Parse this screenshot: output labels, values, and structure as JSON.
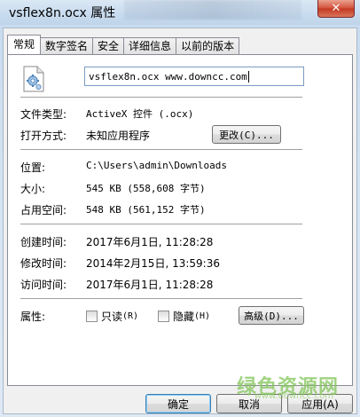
{
  "window": {
    "title": "vsflex8n.ocx 属性",
    "close_glyph": "✕"
  },
  "tabs": [
    {
      "label": "常规",
      "active": true
    },
    {
      "label": "数字签名",
      "active": false
    },
    {
      "label": "安全",
      "active": false
    },
    {
      "label": "详细信息",
      "active": false
    },
    {
      "label": "以前的版本",
      "active": false
    }
  ],
  "general": {
    "file_name": "vsflex8n.ocx  www.downcc.com",
    "file_icon": "activex-file-icon",
    "type_label": "文件类型:",
    "type_value": "ActiveX 控件 (.ocx)",
    "opens_with_label": "打开方式:",
    "opens_with_value": "未知应用程序",
    "change_button": "更改(C)...",
    "location_label": "位置:",
    "location_value": "C:\\Users\\admin\\Downloads",
    "size_label": "大小:",
    "size_value": "545 KB (558,608 字节)",
    "size_on_disk_label": "占用空间:",
    "size_on_disk_value": "548 KB (561,152 字节)",
    "created_label": "创建时间:",
    "created_value": "2017年6月1日, 11:28:28",
    "modified_label": "修改时间:",
    "modified_value": "2014年2月15日, 13:59:36",
    "accessed_label": "访问时间:",
    "accessed_value": "2017年6月1日, 11:28:28",
    "attributes_label": "属性:",
    "readonly_label": "只读",
    "readonly_accel": "(R)",
    "readonly_checked": false,
    "hidden_label": "隐藏",
    "hidden_accel": "(H)",
    "hidden_checked": false,
    "advanced_button": "高级(D)..."
  },
  "footer": {
    "ok_button": "确定",
    "cancel_button": "取消",
    "apply_button": "应用(A)"
  },
  "watermark": {
    "text": "绿色资源网",
    "url": "www.downcc.com"
  }
}
